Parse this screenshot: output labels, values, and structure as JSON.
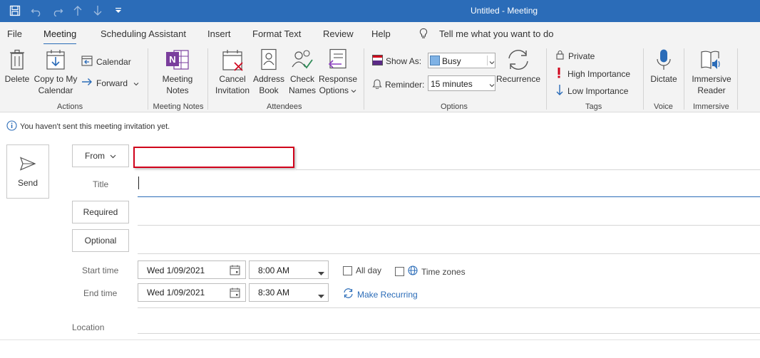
{
  "window": {
    "title": "Untitled  -  Meeting"
  },
  "tabs": [
    "File",
    "Meeting",
    "Scheduling Assistant",
    "Insert",
    "Format Text",
    "Review",
    "Help"
  ],
  "tell_me": "Tell me what you want to do",
  "ribbon": {
    "delete": "Delete",
    "copy_line1": "Copy to My",
    "copy_line2": "Calendar",
    "calendar": "Calendar",
    "forward": "Forward",
    "actions_group": "Actions",
    "meeting_notes_line1": "Meeting",
    "meeting_notes_line2": "Notes",
    "meeting_notes_group": "Meeting Notes",
    "cancel_line1": "Cancel",
    "cancel_line2": "Invitation",
    "address_line1": "Address",
    "address_line2": "Book",
    "check_line1": "Check",
    "check_line2": "Names",
    "response_line1": "Response",
    "response_line2": "Options",
    "attendees_group": "Attendees",
    "show_as_label": "Show As:",
    "show_as_value": "Busy",
    "reminder_label": "Reminder:",
    "reminder_value": "15 minutes",
    "recurrence": "Recurrence",
    "options_group": "Options",
    "private": "Private",
    "high_importance": "High Importance",
    "low_importance": "Low Importance",
    "tags_group": "Tags",
    "dictate": "Dictate",
    "voice_group": "Voice",
    "immersive_line1": "Immersive",
    "immersive_line2": "Reader",
    "immersive_group": "Immersive"
  },
  "info_message": "You haven't sent this meeting invitation yet.",
  "form": {
    "send": "Send",
    "from": "From",
    "from_value": "",
    "title_label": "Title",
    "required": "Required",
    "optional": "Optional",
    "start_time_label": "Start time",
    "end_time_label": "End time",
    "start_date": "Wed 1/09/2021",
    "start_time": "8:00 AM",
    "end_date": "Wed 1/09/2021",
    "end_time": "8:30 AM",
    "all_day": "All day",
    "time_zones": "Time zones",
    "make_recurring": "Make Recurring",
    "location_label": "Location"
  },
  "colors": {
    "titlebar": "#2b6cb8",
    "accent": "#2b6cb8",
    "highlight": "#d0021b",
    "busy": "#7fb2e5"
  }
}
